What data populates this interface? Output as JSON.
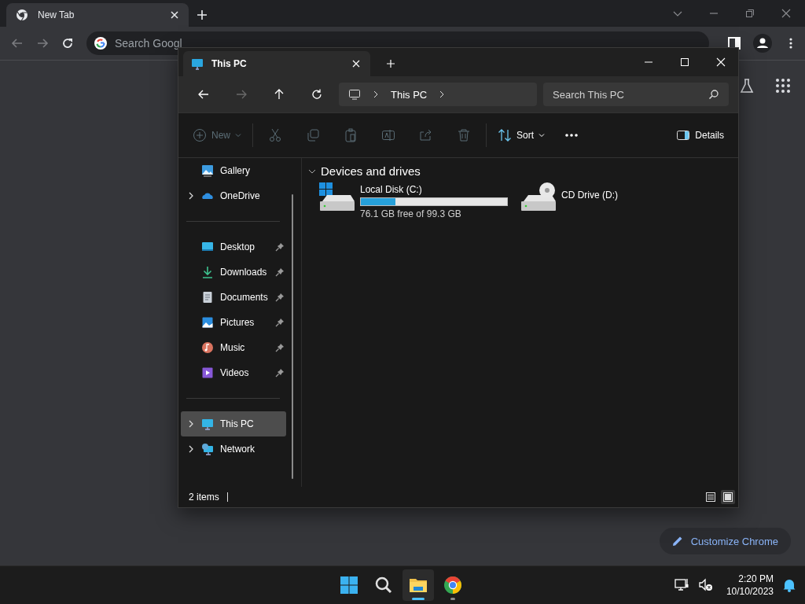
{
  "browser": {
    "tab": {
      "title": "New Tab",
      "selected": true
    },
    "omnibox": {
      "placeholder": "Search Googl"
    },
    "customize_button": "Customize Chrome"
  },
  "explorer": {
    "tab": {
      "title": "This PC"
    },
    "nav_buttons": [
      {
        "kind": "back",
        "disabled": false
      },
      {
        "kind": "forward",
        "disabled": true
      },
      {
        "kind": "up",
        "disabled": false
      },
      {
        "kind": "refresh",
        "disabled": false
      }
    ],
    "address": {
      "location": "This PC"
    },
    "search": {
      "placeholder": "Search This PC"
    },
    "commands": [
      {
        "kind": "new",
        "label": "New",
        "disabled": true
      },
      {
        "kind": "cut",
        "disabled": true
      },
      {
        "kind": "copy",
        "disabled": true
      },
      {
        "kind": "paste",
        "disabled": true
      },
      {
        "kind": "rename",
        "disabled": true
      },
      {
        "kind": "share",
        "disabled": true
      },
      {
        "kind": "delete",
        "disabled": true
      },
      {
        "kind": "sort",
        "label": "Sort",
        "disabled": false
      },
      {
        "kind": "more",
        "disabled": false
      }
    ],
    "details_button": "Details",
    "sidebar": {
      "groups": [
        [
          {
            "kind": "gallery",
            "label": "Gallery",
            "expandable": false,
            "pinned": false,
            "selected": false
          },
          {
            "kind": "onedrive",
            "label": "OneDrive",
            "expandable": true,
            "pinned": false,
            "selected": false
          }
        ],
        [
          {
            "kind": "desktop",
            "label": "Desktop",
            "expandable": false,
            "pinned": true,
            "selected": false
          },
          {
            "kind": "downloads",
            "label": "Downloads",
            "expandable": false,
            "pinned": true,
            "selected": false
          },
          {
            "kind": "documents",
            "label": "Documents",
            "expandable": false,
            "pinned": true,
            "selected": false
          },
          {
            "kind": "pictures",
            "label": "Pictures",
            "expandable": false,
            "pinned": true,
            "selected": false
          },
          {
            "kind": "music",
            "label": "Music",
            "expandable": false,
            "pinned": true,
            "selected": false
          },
          {
            "kind": "videos",
            "label": "Videos",
            "expandable": false,
            "pinned": true,
            "selected": false
          }
        ],
        [
          {
            "kind": "pc",
            "label": "This PC",
            "expandable": true,
            "pinned": false,
            "selected": true
          },
          {
            "kind": "network",
            "label": "Network",
            "expandable": true,
            "pinned": false,
            "selected": false
          }
        ]
      ]
    },
    "section": {
      "title": "Devices and drives",
      "expanded": true
    },
    "drives": [
      {
        "kind": "disk",
        "name": "Local Disk (C:)",
        "level": 0.234,
        "free": "76.1 GB free of 99.3 GB"
      },
      {
        "kind": "cd",
        "name": "CD Drive (D:)"
      }
    ],
    "status_bar": {
      "count": "2 items"
    },
    "view_buttons": [
      {
        "kind": "details",
        "selected": false
      },
      {
        "kind": "tiles",
        "selected": true
      }
    ]
  },
  "taskbar": {
    "apps": [
      {
        "kind": "start",
        "selected": false,
        "running": false
      },
      {
        "kind": "search",
        "selected": false,
        "running": false
      },
      {
        "kind": "explorer",
        "selected": true,
        "running": true
      },
      {
        "kind": "chrome",
        "selected": false,
        "running": true
      }
    ],
    "clock": {
      "time": "2:20 PM",
      "date": "10/10/2023"
    }
  }
}
